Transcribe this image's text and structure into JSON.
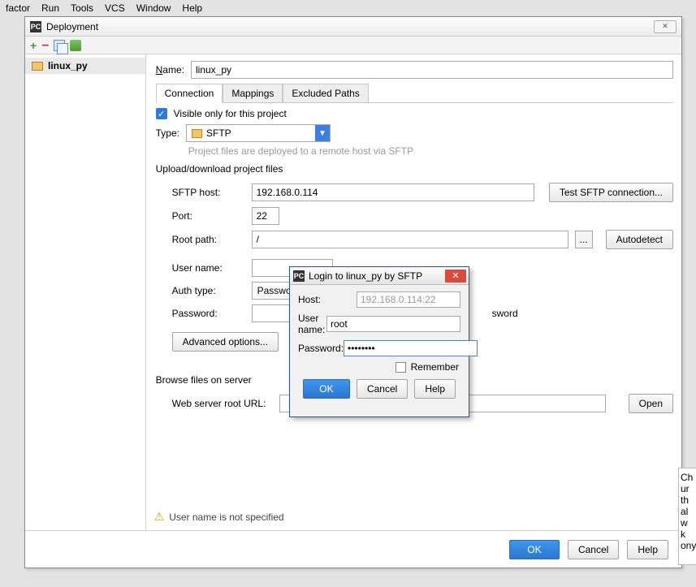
{
  "menubar": [
    "factor",
    "Run",
    "Tools",
    "VCS",
    "Window",
    "Help"
  ],
  "window": {
    "title": "Deployment",
    "name_label": "Name:",
    "name_value": "linux_py",
    "tabs": [
      "Connection",
      "Mappings",
      "Excluded Paths"
    ],
    "visible_only": "Visible only for this project",
    "type_label": "Type:",
    "type_value": "SFTP",
    "type_hint": "Project files are deployed to a remote host via SFTP",
    "section_upload": "Upload/download project files",
    "fields": {
      "sftp_host": {
        "label": "SFTP host:",
        "value": "192.168.0.114"
      },
      "port": {
        "label": "Port:",
        "value": "22"
      },
      "root_path": {
        "label": "Root path:",
        "value": "/"
      },
      "user_name": {
        "label": "User name:",
        "value": ""
      },
      "auth_type": {
        "label": "Auth type:",
        "value": "Passwo"
      },
      "password": {
        "label": "Password:",
        "value": ""
      }
    },
    "test_btn": "Test SFTP connection...",
    "dots_btn": "...",
    "autodetect_btn": "Autodetect",
    "advanced_btn": "Advanced options...",
    "save_partial": "sword",
    "section_browse": "Browse files on server",
    "web_url_label": "Web server root URL:",
    "open_btn": "Open",
    "warning": "User name is not specified",
    "footer": {
      "ok": "OK",
      "cancel": "Cancel",
      "help": "Help"
    }
  },
  "sidebar": {
    "items": [
      {
        "label": "linux_py"
      }
    ]
  },
  "login": {
    "title": "Login to linux_py by SFTP",
    "host_label": "Host:",
    "host_value": "192.168.0.114:22",
    "user_label": "User name:",
    "user_value": "root",
    "pass_label": "Password:",
    "pass_value": "••••••••",
    "remember": "Remember",
    "ok": "OK",
    "cancel": "Cancel",
    "help": "Help"
  },
  "balloon": [
    "Ch",
    "ur",
    "th",
    "al",
    "w k",
    "",
    "ony"
  ]
}
